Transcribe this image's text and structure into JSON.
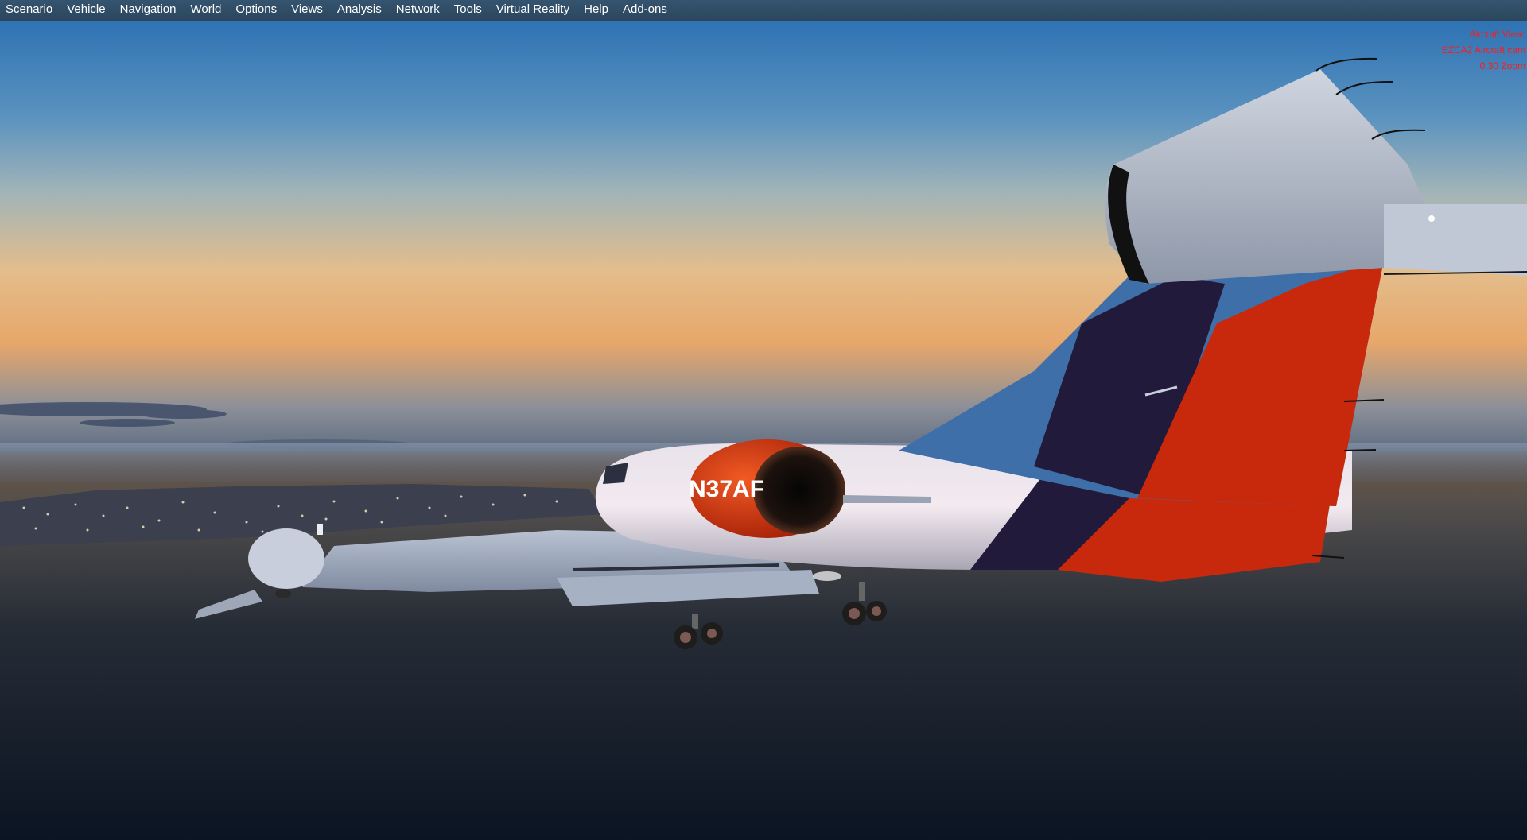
{
  "menu": {
    "items": [
      {
        "id": "scenario",
        "pre": "",
        "key": "S",
        "post": "cenario"
      },
      {
        "id": "vehicle",
        "pre": "V",
        "key": "e",
        "post": "hicle"
      },
      {
        "id": "navigation",
        "pre": "",
        "key": "",
        "post": "Navigation"
      },
      {
        "id": "world",
        "pre": "",
        "key": "W",
        "post": "orld"
      },
      {
        "id": "options",
        "pre": "",
        "key": "O",
        "post": "ptions"
      },
      {
        "id": "views",
        "pre": "",
        "key": "V",
        "post": "iews"
      },
      {
        "id": "analysis",
        "pre": "",
        "key": "A",
        "post": "nalysis"
      },
      {
        "id": "network",
        "pre": "",
        "key": "N",
        "post": "etwork"
      },
      {
        "id": "tools",
        "pre": "",
        "key": "T",
        "post": "ools"
      },
      {
        "id": "virtual-reality",
        "pre": "Virtual ",
        "key": "R",
        "post": "eality"
      },
      {
        "id": "help",
        "pre": "",
        "key": "H",
        "post": "elp"
      },
      {
        "id": "add-ons",
        "pre": "A",
        "key": "d",
        "post": "d-ons"
      }
    ]
  },
  "hud": {
    "line1": "Aircraft View:",
    "line2": "EZCA2 Aircraft cam",
    "line3": "0.30 Zoom"
  },
  "aircraft": {
    "registration": "N37AF"
  },
  "colors": {
    "menubar": "#2f4c66",
    "hud_text": "#ff1a1a",
    "livery_red": "#c8290c",
    "livery_blue": "#3f6fa8",
    "livery_navy": "#221a3a"
  }
}
